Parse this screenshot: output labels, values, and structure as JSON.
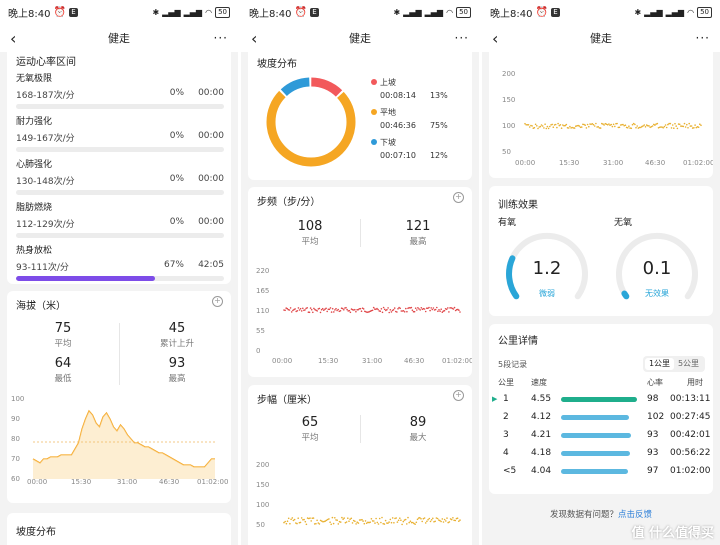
{
  "status": {
    "time": "晚上8:40",
    "signal": "⁴ᴳ",
    "battery": "50"
  },
  "nav": {
    "title": "健走",
    "back": "‹",
    "more": "···"
  },
  "hr": {
    "title": "运动心率区间",
    "zones": [
      {
        "name": "无氧极限",
        "range": "168-187次/分",
        "pct": "0%",
        "time": "00:00",
        "fill": 0
      },
      {
        "name": "耐力强化",
        "range": "149-167次/分",
        "pct": "0%",
        "time": "00:00",
        "fill": 0
      },
      {
        "name": "心肺强化",
        "range": "130-148次/分",
        "pct": "0%",
        "time": "00:00",
        "fill": 0
      },
      {
        "name": "脂肪燃烧",
        "range": "112-129次/分",
        "pct": "0%",
        "time": "00:00",
        "fill": 0
      },
      {
        "name": "热身放松",
        "range": "93-111次/分",
        "pct": "67%",
        "time": "42:05",
        "fill": 0.67
      }
    ]
  },
  "altitude": {
    "title": "海拔（米）",
    "stats": [
      {
        "value": "75",
        "label": "平均"
      },
      {
        "value": "45",
        "label": "累计上升"
      },
      {
        "value": "64",
        "label": "最低"
      },
      {
        "value": "93",
        "label": "最高"
      }
    ],
    "yticks": [
      "100",
      "90",
      "80",
      "70",
      "60"
    ],
    "xticks": [
      "00:00",
      "15:30",
      "31:00",
      "46:30",
      "01:02:00"
    ]
  },
  "slope_title": "坡度分布",
  "slope": {
    "title": "坡度分布",
    "items": [
      {
        "name": "上坡",
        "time": "00:08:14",
        "pct": "13%",
        "color": "#f2595b",
        "fraction": 0.13
      },
      {
        "name": "平地",
        "time": "00:46:36",
        "pct": "75%",
        "color": "#f5a623",
        "fraction": 0.75
      },
      {
        "name": "下坡",
        "time": "00:07:10",
        "pct": "12%",
        "color": "#2f9ad8",
        "fraction": 0.12
      }
    ]
  },
  "cadence": {
    "title": "步频（步/分）",
    "stats": [
      {
        "value": "108",
        "label": "平均"
      },
      {
        "value": "121",
        "label": "最高"
      }
    ],
    "yticks": [
      "220",
      "165",
      "110",
      "55",
      "0"
    ],
    "xticks": [
      "00:00",
      "15:30",
      "31:00",
      "46:30",
      "01:02:00"
    ]
  },
  "stride": {
    "title": "步幅（厘米）",
    "stats": [
      {
        "value": "65",
        "label": "平均"
      },
      {
        "value": "89",
        "label": "最大"
      }
    ],
    "yticks": [
      "200",
      "150",
      "100",
      "50"
    ]
  },
  "hrchart": {
    "yticks": [
      "200",
      "150",
      "100",
      "50"
    ],
    "xticks": [
      "00:00",
      "15:30",
      "31:00",
      "46:30",
      "01:02:00"
    ]
  },
  "training": {
    "title": "训练效果",
    "aerobic": {
      "label": "有氧",
      "value": "1.2",
      "desc": "微弱",
      "fraction": 0.24,
      "color": "#2aa6d8"
    },
    "anaerobic": {
      "label": "无氧",
      "value": "0.1",
      "desc": "无效果",
      "fraction": 0.02,
      "color": "#2aa6d8"
    }
  },
  "km": {
    "title": "公里详情",
    "records": "5段记录",
    "tab1": "1公里",
    "tab2": "5公里",
    "headers": {
      "km": "公里",
      "speed": "速度",
      "hr": "心率",
      "time": "用时"
    },
    "rows": [
      {
        "km": "1",
        "speed": "4.55",
        "hr": "98",
        "time": "00:13:11",
        "fill": 1.0,
        "best": true
      },
      {
        "km": "2",
        "speed": "4.12",
        "hr": "102",
        "time": "00:27:45",
        "fill": 0.9,
        "best": false
      },
      {
        "km": "3",
        "speed": "4.21",
        "hr": "93",
        "time": "00:42:01",
        "fill": 0.92,
        "best": false
      },
      {
        "km": "4",
        "speed": "4.18",
        "hr": "93",
        "time": "00:56:22",
        "fill": 0.91,
        "best": false
      },
      {
        "km": "<5",
        "speed": "4.04",
        "hr": "97",
        "time": "01:02:00",
        "fill": 0.88,
        "best": false
      }
    ],
    "feedback": "发现数据有问题？",
    "feedback_link": "点击反馈",
    "watermark": "值 什么值得买"
  },
  "colors": {
    "accent_purple": "#7d4ce8",
    "line_orange": "#f5a623",
    "cadence_red": "#e0484a",
    "best_green": "#1fae8c",
    "bar_blue": "#5cb8e0"
  }
}
